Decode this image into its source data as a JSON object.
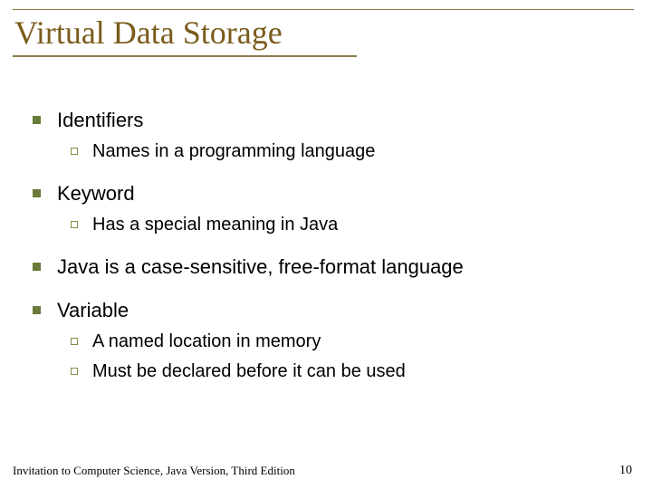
{
  "title": "Virtual Data Storage",
  "bullets": {
    "b1": "Identifiers",
    "b1_1": "Names in a programming language",
    "b2": "Keyword",
    "b2_1": "Has a special meaning in Java",
    "b3": "Java is a case-sensitive, free-format language",
    "b4": "Variable",
    "b4_1": "A named location in memory",
    "b4_2": "Must be declared before it can be used"
  },
  "footer": {
    "text": "Invitation to Computer Science, Java Version, Third Edition",
    "page": "10"
  }
}
